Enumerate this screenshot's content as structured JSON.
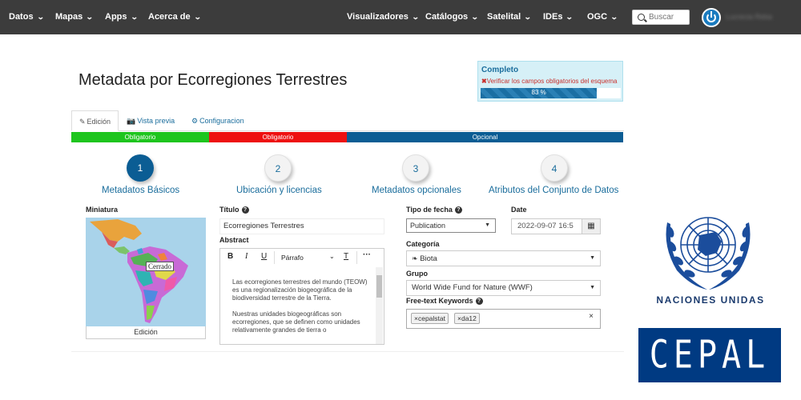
{
  "nav": {
    "left": [
      "Datos",
      "Mapas",
      "Apps",
      "Acerca de"
    ],
    "right": [
      "Visualizadores",
      "Catálogos",
      "Satelital",
      "IDEs",
      "OGC"
    ],
    "search_placeholder": "Buscar",
    "user": "Lucrecia Reba"
  },
  "title": "Metadata por Ecorregiones Terrestres",
  "status": {
    "title": "Completo",
    "warning": "Verificar los campos obligatorios del esquema",
    "progress_percent": 83,
    "progress_label": "83 %"
  },
  "tabs": [
    "Edición",
    "Vista previa",
    "Configuracion"
  ],
  "band": [
    "Obligatorio",
    "Obligatorio",
    "Opcional"
  ],
  "steps": [
    {
      "num": "1",
      "label": "Metadatos Básicos"
    },
    {
      "num": "2",
      "label": "Ubicación y licencias"
    },
    {
      "num": "3",
      "label": "Metadatos opcionales"
    },
    {
      "num": "4",
      "label": "Atributos del Conjunto de Datos"
    }
  ],
  "form": {
    "miniatura_label": "Miniatura",
    "thumb_tag": "Cerrado",
    "thumb_caption": "Edición",
    "titulo_label": "Título",
    "titulo_value": "Ecorregiones Terrestres",
    "abstract_label": "Abstract",
    "editor_style": "Párrafo",
    "abstract_p1": "Las ecorregiones terrestres del mundo (TEOW) es una regionalización biogeográfica de la biodiversidad terrestre de la Tierra.",
    "abstract_p2": "Nuestras unidades biogeográficas son ecorregiones, que se definen como unidades relativamente grandes de tierra o",
    "tipo_fecha_label": "Tipo de fecha",
    "tipo_fecha_value": "Publication",
    "date_label": "Date",
    "date_value": "2022-09-07 16:5",
    "categoria_label": "Categoría",
    "categoria_value": "Biota",
    "grupo_label": "Grupo",
    "grupo_value": "World Wide Fund for Nature (WWF)",
    "keywords_label": "Free-text Keywords",
    "keywords": [
      "cepalstat",
      "da12"
    ]
  },
  "logos": {
    "un_text": "Naciones Unidas",
    "cepal_text": "CEPAL"
  },
  "colors": {
    "navbar": "#3c3c3c",
    "accent": "#1a6d9c",
    "band_green": "#1ec51e",
    "band_red": "#ee1111",
    "band_blue": "#0b5d94"
  }
}
